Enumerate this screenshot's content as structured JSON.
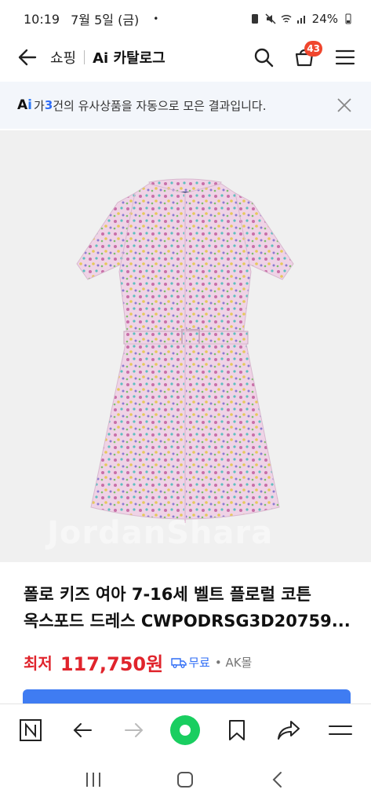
{
  "status_bar": {
    "time": "10:19",
    "date": "7월 5일 (금)",
    "dot": "•",
    "battery": "24%"
  },
  "header": {
    "crumb_shopping": "쇼핑",
    "crumb_catalog": "Ai 카탈로그",
    "cart_count": "43"
  },
  "banner": {
    "ai_prefix": "A",
    "ai_i": "i",
    "text_before": "가 ",
    "count": "3",
    "text_after": "건의 유사상품을 자동으로 모은 결과입니다."
  },
  "product": {
    "watermark": "JordanShara",
    "title_line1": "폴로 키즈 여아 7-16세 벨트 플로럴 코튼",
    "title_line2": "옥스포드 드레스 CWPODRSG3D20759...",
    "price_label": "최저",
    "price": "117,750원",
    "shipping": "무료",
    "mall": "• AK몰"
  },
  "colors": {
    "accent_blue": "#2f6df6",
    "price_red": "#e0242c",
    "badge_red": "#f0462d",
    "naver_green": "#19ce60"
  }
}
